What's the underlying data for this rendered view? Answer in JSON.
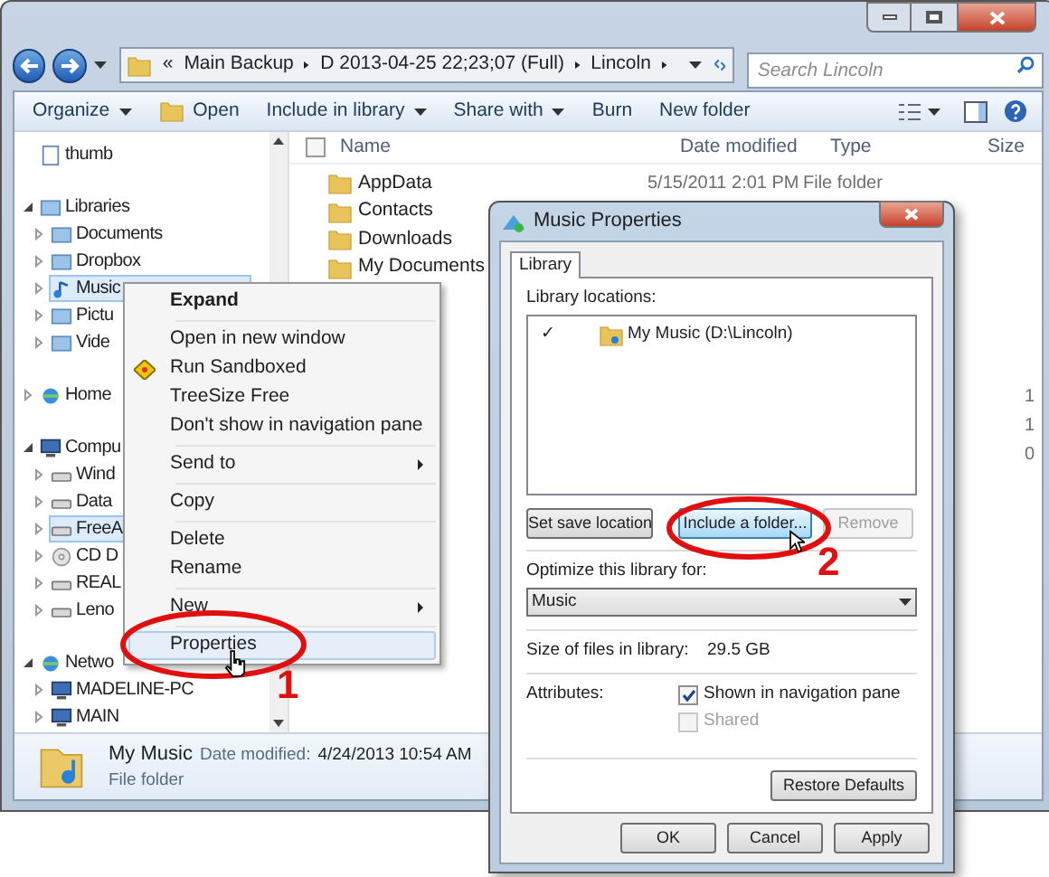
{
  "address_bar": {
    "overflow": "«",
    "crumbs": [
      "Main Backup",
      "D 2013-04-25 22;23;07 (Full)",
      "Lincoln"
    ]
  },
  "search": {
    "placeholder": "Search Lincoln"
  },
  "toolbar": [
    {
      "label": "Organize",
      "dropdown": true,
      "icon": false
    },
    {
      "label": "Open",
      "dropdown": false,
      "icon": true
    },
    {
      "label": "Include in library",
      "dropdown": true,
      "icon": false
    },
    {
      "label": "Share with",
      "dropdown": true,
      "icon": false
    },
    {
      "label": "Burn",
      "dropdown": false,
      "icon": false
    },
    {
      "label": "New folder",
      "dropdown": false,
      "icon": false
    }
  ],
  "nav_pane": [
    {
      "label": "thumb",
      "kind": "file",
      "selected": false
    },
    {
      "label": "Libraries",
      "kind": "library",
      "expanded": true,
      "selected": false,
      "children": [
        {
          "label": "Documents",
          "kind": "library",
          "selected": false
        },
        {
          "label": "Dropbox",
          "kind": "library",
          "selected": false
        },
        {
          "label": "Music",
          "kind": "music",
          "selected": true
        },
        {
          "label": "Pictu",
          "kind": "library",
          "selected": false
        },
        {
          "label": "Vide",
          "kind": "library",
          "selected": false
        }
      ]
    },
    {
      "label": "Home",
      "kind": "network",
      "expanded": false,
      "selected": false
    },
    {
      "label": "Compu",
      "kind": "computer",
      "expanded": true,
      "selected": false,
      "children": [
        {
          "label": "Wind",
          "kind": "drive",
          "selected": false
        },
        {
          "label": "Data",
          "kind": "drive",
          "selected": false
        },
        {
          "label": "FreeA",
          "kind": "drive",
          "selected": true
        },
        {
          "label": "CD D",
          "kind": "disc",
          "selected": false
        },
        {
          "label": "REAL",
          "kind": "drive",
          "selected": false
        },
        {
          "label": "Leno",
          "kind": "drive",
          "selected": false
        }
      ]
    },
    {
      "label": "Netwo",
      "kind": "network",
      "expanded": true,
      "selected": false,
      "children": [
        {
          "label": "MADELINE-PC",
          "kind": "computer",
          "selected": false
        },
        {
          "label": "MAIN",
          "kind": "computer",
          "selected": false
        }
      ]
    }
  ],
  "file_list": {
    "select_all": {
      "checked": false
    },
    "columns": [
      "Name",
      "Date modified",
      "Type",
      "Size"
    ],
    "rows": [
      {
        "name": "AppData",
        "date": "5/15/2011 2:01 PM",
        "type": "File folder"
      },
      {
        "name": "Contacts"
      },
      {
        "name": "Downloads"
      },
      {
        "name": "My Documents"
      }
    ],
    "sizes": [
      "1",
      "1",
      "0"
    ]
  },
  "details_pane": {
    "name": "My Music",
    "date_label": "Date modified:",
    "date": "4/24/2013 10:54 AM",
    "type": "File folder"
  },
  "context_menu": [
    {
      "kind": "item",
      "label": "Expand",
      "default": true,
      "submenu": false,
      "icon": false,
      "selected": false
    },
    {
      "kind": "separator"
    },
    {
      "kind": "item",
      "label": "Open in new window",
      "default": false,
      "submenu": false,
      "icon": false,
      "selected": false
    },
    {
      "kind": "item",
      "label": "Run Sandboxed",
      "default": false,
      "submenu": false,
      "icon": true,
      "selected": false
    },
    {
      "kind": "item",
      "label": "TreeSize Free",
      "default": false,
      "submenu": false,
      "icon": false,
      "selected": false
    },
    {
      "kind": "item",
      "label": "Don't show in navigation pane",
      "default": false,
      "submenu": false,
      "icon": false,
      "selected": false
    },
    {
      "kind": "separator"
    },
    {
      "kind": "item",
      "label": "Send to",
      "default": false,
      "submenu": true,
      "icon": false,
      "selected": false
    },
    {
      "kind": "separator"
    },
    {
      "kind": "item",
      "label": "Copy",
      "default": false,
      "submenu": false,
      "icon": false,
      "selected": false
    },
    {
      "kind": "separator"
    },
    {
      "kind": "item",
      "label": "Delete",
      "default": false,
      "submenu": false,
      "icon": false,
      "selected": false
    },
    {
      "kind": "item",
      "label": "Rename",
      "default": false,
      "submenu": false,
      "icon": false,
      "selected": false
    },
    {
      "kind": "separator"
    },
    {
      "kind": "item",
      "label": "New",
      "default": false,
      "submenu": true,
      "icon": false,
      "selected": false
    },
    {
      "kind": "separator"
    },
    {
      "kind": "item",
      "label": "Properties",
      "default": false,
      "submenu": false,
      "icon": false,
      "selected": true
    }
  ],
  "dialog": {
    "title": "Music Properties",
    "tabs": [
      {
        "label": "Library",
        "selected": true
      }
    ],
    "locations_label": "Library locations:",
    "locations": [
      {
        "check": "✓",
        "name": "My Music (D:\\Lincoln)"
      }
    ],
    "location_buttons": [
      {
        "label": "Set save location",
        "disabled": false,
        "hover": false
      },
      {
        "label": "Include a folder...",
        "disabled": false,
        "hover": true
      },
      {
        "label": "Remove",
        "disabled": true,
        "hover": false
      }
    ],
    "optimize_label": "Optimize this library for:",
    "optimize_value": "Music",
    "size_label": "Size of files in library:",
    "size_value": "29.5 GB",
    "attributes_label": "Attributes:",
    "attributes": [
      {
        "label": "Shown in navigation pane",
        "checked": true,
        "disabled": false
      },
      {
        "label": "Shared",
        "checked": false,
        "disabled": true
      }
    ],
    "restore_button": "Restore Defaults",
    "buttons": [
      "OK",
      "Cancel",
      "Apply"
    ]
  },
  "annotations": [
    "1",
    "2"
  ]
}
